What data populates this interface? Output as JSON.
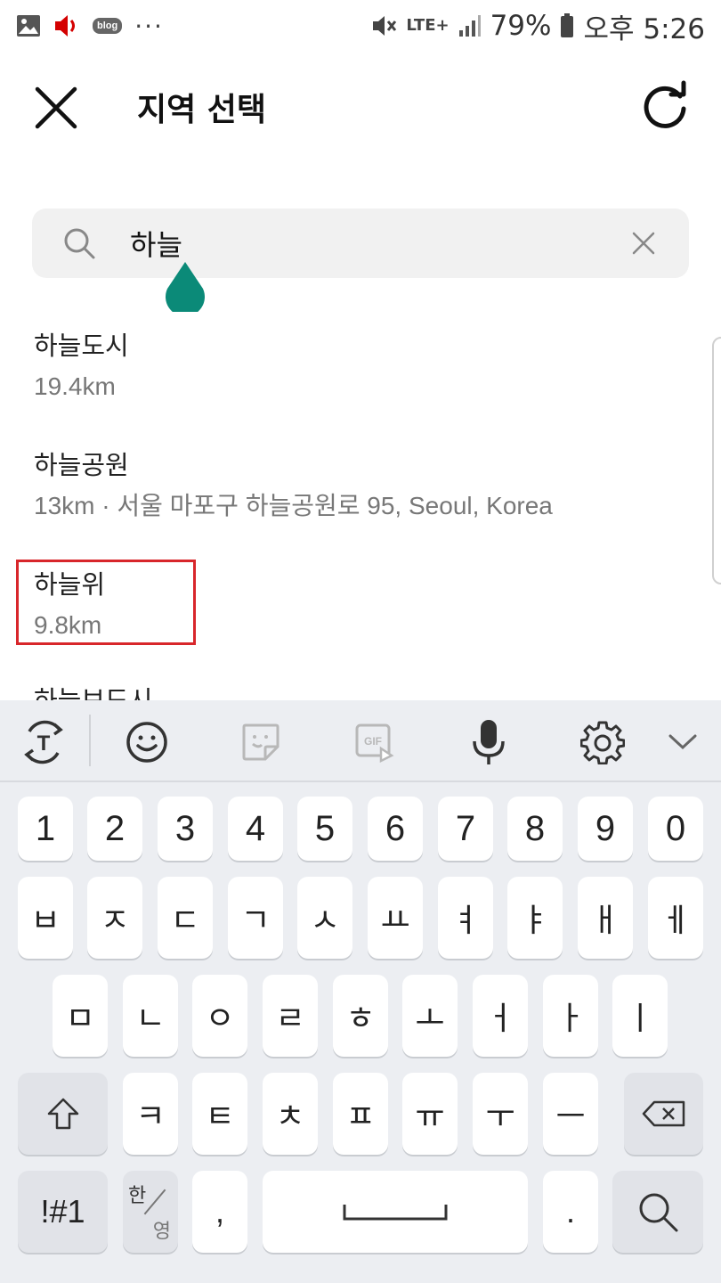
{
  "status_bar": {
    "blog_badge": "blog",
    "more_dots": "···",
    "network": "LTE+",
    "battery": "79%",
    "time": "오후 5:26"
  },
  "header": {
    "title": "지역 선택"
  },
  "search": {
    "value": "하늘",
    "placeholder": ""
  },
  "results": [
    {
      "name": "하늘도시",
      "detail": "19.4km"
    },
    {
      "name": "하늘공원",
      "detail": "13km · 서울 마포구 하늘공원로 95, Seoul, Korea"
    },
    {
      "name": "하늘위",
      "detail": "9.8km"
    },
    {
      "name": "하늘보도시",
      "detail": ""
    }
  ],
  "colors": {
    "accent": "#0b8a78",
    "highlight": "#d8262b",
    "keyboard_bg": "#eceef2"
  },
  "keyboard": {
    "toolbar_icons": [
      "text-mode-icon",
      "emoji-icon",
      "sticker-icon",
      "gif-icon",
      "mic-icon",
      "gear-icon",
      "chevron-down-icon"
    ],
    "gif_label": "GIF",
    "text_mode_label": "T",
    "row_numbers": [
      "1",
      "2",
      "3",
      "4",
      "5",
      "6",
      "7",
      "8",
      "9",
      "0"
    ],
    "row1": [
      "ㅂ",
      "ㅈ",
      "ㄷ",
      "ㄱ",
      "ㅅ",
      "ㅛ",
      "ㅕ",
      "ㅑ",
      "ㅐ",
      "ㅔ"
    ],
    "row2": [
      "ㅁ",
      "ㄴ",
      "ㅇ",
      "ㄹ",
      "ㅎ",
      "ㅗ",
      "ㅓ",
      "ㅏ",
      "ㅣ"
    ],
    "row3": [
      "ㅋ",
      "ㅌ",
      "ㅊ",
      "ㅍ",
      "ㅠ",
      "ㅜ",
      "ㅡ"
    ],
    "symbols_label": "!#1",
    "lang_top": "한",
    "lang_bottom": "영",
    "comma": ",",
    "period": "."
  }
}
